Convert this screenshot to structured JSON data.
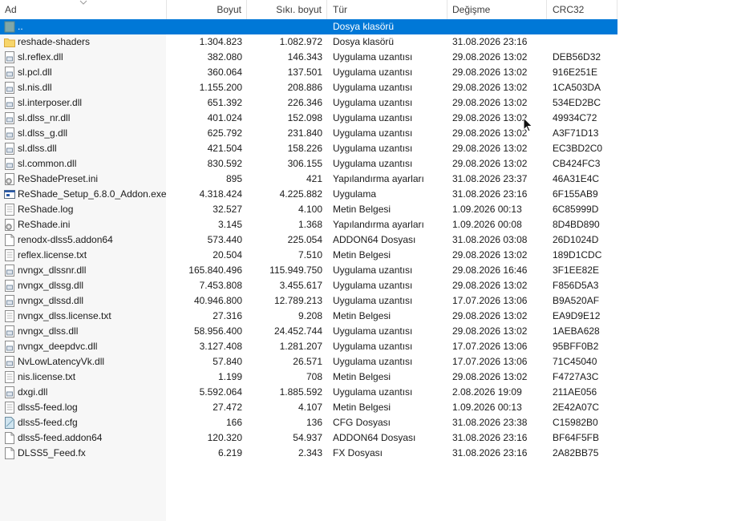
{
  "columns": {
    "name": "Ad",
    "size": "Boyut",
    "packed": "Sıkı. boyut",
    "type": "Tür",
    "modified": "Değişme",
    "crc": "CRC32"
  },
  "rows": [
    {
      "name": "..",
      "size": "",
      "packed": "",
      "type": "Dosya klasörü",
      "modified": "",
      "crc": "",
      "icon": "parent-folder-icon",
      "selected": true
    },
    {
      "name": "reshade-shaders",
      "size": "1.304.823",
      "packed": "1.082.972",
      "type": "Dosya klasörü",
      "modified": "31.08.2026 23:16",
      "crc": "",
      "icon": "folder-icon"
    },
    {
      "name": "sl.reflex.dll",
      "size": "382.080",
      "packed": "146.343",
      "type": "Uygulama uzantısı",
      "modified": "29.08.2026 13:02",
      "crc": "DEB56D32",
      "icon": "dll-icon"
    },
    {
      "name": "sl.pcl.dll",
      "size": "360.064",
      "packed": "137.501",
      "type": "Uygulama uzantısı",
      "modified": "29.08.2026 13:02",
      "crc": "916E251E",
      "icon": "dll-icon"
    },
    {
      "name": "sl.nis.dll",
      "size": "1.155.200",
      "packed": "208.886",
      "type": "Uygulama uzantısı",
      "modified": "29.08.2026 13:02",
      "crc": "1CA503DA",
      "icon": "dll-icon"
    },
    {
      "name": "sl.interposer.dll",
      "size": "651.392",
      "packed": "226.346",
      "type": "Uygulama uzantısı",
      "modified": "29.08.2026 13:02",
      "crc": "534ED2BC",
      "icon": "dll-icon"
    },
    {
      "name": "sl.dlss_nr.dll",
      "size": "401.024",
      "packed": "152.098",
      "type": "Uygulama uzantısı",
      "modified": "29.08.2026 13:02",
      "crc": "49934C72",
      "icon": "dll-icon"
    },
    {
      "name": "sl.dlss_g.dll",
      "size": "625.792",
      "packed": "231.840",
      "type": "Uygulama uzantısı",
      "modified": "29.08.2026 13:02",
      "crc": "A3F71D13",
      "icon": "dll-icon"
    },
    {
      "name": "sl.dlss.dll",
      "size": "421.504",
      "packed": "158.226",
      "type": "Uygulama uzantısı",
      "modified": "29.08.2026 13:02",
      "crc": "EC3BD2C0",
      "icon": "dll-icon"
    },
    {
      "name": "sl.common.dll",
      "size": "830.592",
      "packed": "306.155",
      "type": "Uygulama uzantısı",
      "modified": "29.08.2026 13:02",
      "crc": "CB424FC3",
      "icon": "dll-icon"
    },
    {
      "name": "ReShadePreset.ini",
      "size": "895",
      "packed": "421",
      "type": "Yapılandırma ayarları",
      "modified": "31.08.2026 23:37",
      "crc": "46A31E4C",
      "icon": "ini-settings-icon"
    },
    {
      "name": "ReShade_Setup_6.8.0_Addon.exe",
      "size": "4.318.424",
      "packed": "4.225.882",
      "type": "Uygulama",
      "modified": "31.08.2026 23:16",
      "crc": "6F155AB9",
      "icon": "exe-icon"
    },
    {
      "name": "ReShade.log",
      "size": "32.527",
      "packed": "4.100",
      "type": "Metin Belgesi",
      "modified": "1.09.2026 00:13",
      "crc": "6C85999D",
      "icon": "text-file-icon"
    },
    {
      "name": "ReShade.ini",
      "size": "3.145",
      "packed": "1.368",
      "type": "Yapılandırma ayarları",
      "modified": "1.09.2026 00:08",
      "crc": "8D4BD890",
      "icon": "ini-settings-icon"
    },
    {
      "name": "renodx-dlss5.addon64",
      "size": "573.440",
      "packed": "225.054",
      "type": "ADDON64 Dosyası",
      "modified": "31.08.2026 03:08",
      "crc": "26D1024D",
      "icon": "file-icon"
    },
    {
      "name": "reflex.license.txt",
      "size": "20.504",
      "packed": "7.510",
      "type": "Metin Belgesi",
      "modified": "29.08.2026 13:02",
      "crc": "189D1CDC",
      "icon": "text-file-icon"
    },
    {
      "name": "nvngx_dlssnr.dll",
      "size": "165.840.496",
      "packed": "115.949.750",
      "type": "Uygulama uzantısı",
      "modified": "29.08.2026 16:46",
      "crc": "3F1EE82E",
      "icon": "dll-icon"
    },
    {
      "name": "nvngx_dlssg.dll",
      "size": "7.453.808",
      "packed": "3.455.617",
      "type": "Uygulama uzantısı",
      "modified": "29.08.2026 13:02",
      "crc": "F856D5A3",
      "icon": "dll-icon"
    },
    {
      "name": "nvngx_dlssd.dll",
      "size": "40.946.800",
      "packed": "12.789.213",
      "type": "Uygulama uzantısı",
      "modified": "17.07.2026 13:06",
      "crc": "B9A520AF",
      "icon": "dll-icon"
    },
    {
      "name": "nvngx_dlss.license.txt",
      "size": "27.316",
      "packed": "9.208",
      "type": "Metin Belgesi",
      "modified": "29.08.2026 13:02",
      "crc": "EA9D9E12",
      "icon": "text-file-icon"
    },
    {
      "name": "nvngx_dlss.dll",
      "size": "58.956.400",
      "packed": "24.452.744",
      "type": "Uygulama uzantısı",
      "modified": "29.08.2026 13:02",
      "crc": "1AEBA628",
      "icon": "dll-icon"
    },
    {
      "name": "nvngx_deepdvc.dll",
      "size": "3.127.408",
      "packed": "1.281.207",
      "type": "Uygulama uzantısı",
      "modified": "17.07.2026 13:06",
      "crc": "95BFF0B2",
      "icon": "dll-icon"
    },
    {
      "name": "NvLowLatencyVk.dll",
      "size": "57.840",
      "packed": "26.571",
      "type": "Uygulama uzantısı",
      "modified": "17.07.2026 13:06",
      "crc": "71C45040",
      "icon": "dll-icon"
    },
    {
      "name": "nis.license.txt",
      "size": "1.199",
      "packed": "708",
      "type": "Metin Belgesi",
      "modified": "29.08.2026 13:02",
      "crc": "F4727A3C",
      "icon": "text-file-icon"
    },
    {
      "name": "dxgi.dll",
      "size": "5.592.064",
      "packed": "1.885.592",
      "type": "Uygulama uzantısı",
      "modified": "2.08.2026 19:09",
      "crc": "211AE056",
      "icon": "dll-icon"
    },
    {
      "name": "dlss5-feed.log",
      "size": "27.472",
      "packed": "4.107",
      "type": "Metin Belgesi",
      "modified": "1.09.2026 00:13",
      "crc": "2E42A07C",
      "icon": "text-file-icon"
    },
    {
      "name": "dlss5-feed.cfg",
      "size": "166",
      "packed": "136",
      "type": "CFG Dosyası",
      "modified": "31.08.2026 23:38",
      "crc": "C15982B0",
      "icon": "cfg-file-icon"
    },
    {
      "name": "dlss5-feed.addon64",
      "size": "120.320",
      "packed": "54.937",
      "type": "ADDON64 Dosyası",
      "modified": "31.08.2026 23:16",
      "crc": "BF64F5FB",
      "icon": "file-icon"
    },
    {
      "name": "DLSS5_Feed.fx",
      "size": "6.219",
      "packed": "2.343",
      "type": "FX Dosyası",
      "modified": "31.08.2026 23:16",
      "crc": "2A82BB75",
      "icon": "file-icon"
    }
  ]
}
